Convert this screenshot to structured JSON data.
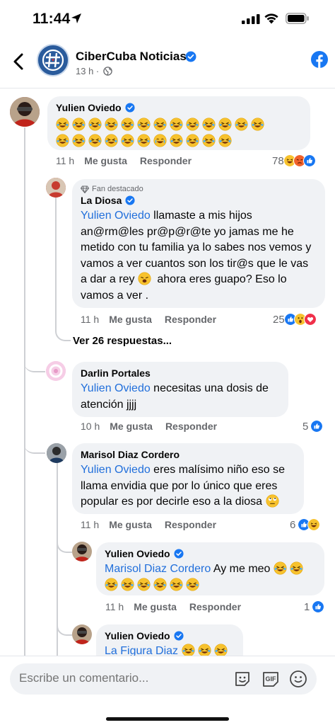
{
  "status": {
    "time": "11:44"
  },
  "header": {
    "page_name": "CiberCuba Noticias",
    "meta": "13 h ·"
  },
  "comments": [
    {
      "author": "Yulien Oviedo",
      "text": "",
      "emoji_count": 13,
      "emoji_row2": 11,
      "time": "11 h",
      "like": "Me gusta",
      "reply": "Responder",
      "reactions": "78"
    },
    {
      "badge": "Fan destacado",
      "author": "La Diosa",
      "mention": "Yulien Oviedo",
      "text_a": " llamaste a mis hijos an@rm@les pr@p@r@te yo jamas me he metido con tu familia ya lo sabes nos vemos y vamos a ver cuantos son los tir@s que le vas a dar a rey ",
      "text_b": " ahora eres guapo? Eso lo vamos a ver .",
      "time": "11 h",
      "like": "Me gusta",
      "reply": "Responder",
      "reactions": "25"
    },
    {
      "author": "Darlin Portales",
      "mention": "Yulien Oviedo",
      "text": " necesitas una dosis de atención jjjj",
      "time": "10 h",
      "like": "Me gusta",
      "reply": "Responder",
      "reactions": "5"
    },
    {
      "author": "Marisol Diaz Cordero",
      "mention": "Yulien Oviedo",
      "text": " eres malísimo niño eso se llama envidia que por lo único que eres popular es por decirle eso a la diosa ",
      "time": "11 h",
      "like": "Me gusta",
      "reply": "Responder",
      "reactions": "6"
    },
    {
      "author": "Yulien Oviedo",
      "mention": "Marisol Diaz Cordero",
      "text": " Ay me meo ",
      "time": "11 h",
      "like": "Me gusta",
      "reply": "Responder",
      "reactions": "1"
    },
    {
      "author": "Yulien Oviedo",
      "mention": "La Figura Diaz",
      "text": " "
    }
  ],
  "more_replies": "Ver 26 respuestas...",
  "composer": {
    "placeholder": "Escribe un comentario..."
  },
  "colors": {
    "accent": "#1877f2",
    "mention": "#216fdb",
    "bubble": "#f0f2f5",
    "muted": "#65676b"
  },
  "icons": [
    "location-arrow-icon",
    "signal-icon",
    "wifi-icon",
    "battery-icon",
    "back-icon",
    "verified-icon",
    "globe-icon",
    "facebook-icon",
    "sticker-icon",
    "gif-icon",
    "smile-icon",
    "laugh-emoji",
    "like-reaction",
    "haha-reaction",
    "angry-reaction",
    "wow-reaction",
    "love-reaction"
  ]
}
